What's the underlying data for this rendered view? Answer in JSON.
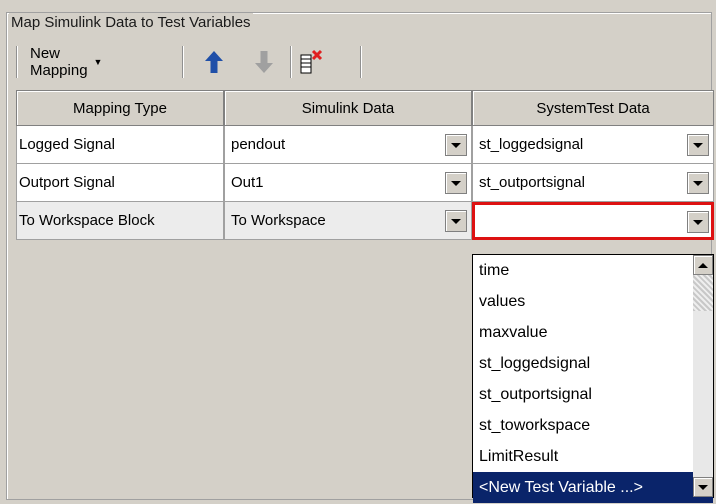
{
  "groupbox": {
    "title": "Map Simulink Data to Test Variables"
  },
  "toolbar": {
    "new_mapping_label": "New Mapping",
    "icons": [
      "move-up-icon",
      "move-down-icon",
      "delete-mapping-icon"
    ]
  },
  "table": {
    "headers": [
      "Mapping Type",
      "Simulink Data",
      "SystemTest Data"
    ],
    "rows": [
      {
        "type": "Logged Signal",
        "simulink": "pendout",
        "systemtest": "st_loggedsignal"
      },
      {
        "type": "Outport Signal",
        "simulink": "Out1",
        "systemtest": "st_outportsignal"
      },
      {
        "type": "To Workspace Block",
        "simulink": "To Workspace",
        "systemtest": ""
      }
    ]
  },
  "dropdown": {
    "options": [
      "time",
      "values",
      "maxvalue",
      "st_loggedsignal",
      "st_outportsignal",
      "st_toworkspace",
      "LimitResult",
      "<New Test Variable ...>"
    ],
    "selected_index": 7
  },
  "colors": {
    "selection": "#0a246a",
    "active_border": "#dd1111",
    "arrow_up": "#1f4fa8",
    "arrow_disabled": "#a0a0a0",
    "delete_x": "#e02020"
  }
}
